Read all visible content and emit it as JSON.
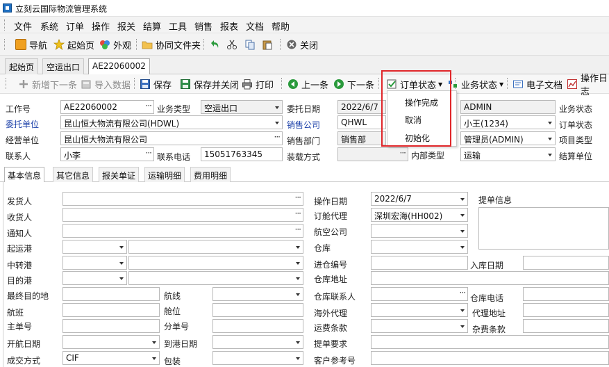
{
  "app": {
    "title": "立刻云国际物流管理系统"
  },
  "menu": [
    "文件",
    "系统",
    "订单",
    "操作",
    "报关",
    "结算",
    "工具",
    "销售",
    "报表",
    "文档",
    "帮助"
  ],
  "toolbar": {
    "nav": "导航",
    "home": "起始页",
    "appearance": "外观",
    "shared": "协同文件夹",
    "close": "关闭"
  },
  "doc_tabs": [
    "起始页",
    "空运出口",
    "AE22060002"
  ],
  "actions": {
    "add_next": "新增下一条",
    "import": "导入数据",
    "save": "保存",
    "save_close": "保存并关闭",
    "print": "打印",
    "prev": "上一条",
    "next": "下一条",
    "order_status": "订单状态",
    "biz_status": "业务状态",
    "e_docs": "电子文档",
    "op_log": "操作日志"
  },
  "status_menu": [
    "操作完成",
    "取消",
    "初始化"
  ],
  "header_form": {
    "job_no_label": "工作号",
    "job_no": "AE22060002",
    "biz_type_label": "业务类型",
    "biz_type": "空运出口",
    "entrust_date_label": "委托日期",
    "entrust_date": "2022/6/7",
    "creator": "ADMIN",
    "biz_status_label": "业务状态",
    "client_label": "委托单位",
    "client": "昆山恒大物流有限公司(HDWL)",
    "sales_co_label": "销售公司",
    "sales_co": "QHWL",
    "salesman": "小王(1234)",
    "order_status_label": "订单状态",
    "operator_label": "经营单位",
    "operator": "昆山恒大物流有限公司",
    "sales_dept_label": "销售部门",
    "sales_dept": "销售部",
    "manager": "管理员(ADMIN)",
    "project_type_label": "项目类型",
    "contact_label": "联系人",
    "contact": "小李",
    "phone_label": "联系电话",
    "phone": "15051763345",
    "loading_label": "装载方式",
    "internal_type_label": "内部类型",
    "internal_type": "运输",
    "settle_unit_label": "结算单位"
  },
  "sub_tabs": [
    "基本信息",
    "其它信息",
    "报关单证",
    "运输明细",
    "费用明细"
  ],
  "basic": {
    "shipper": "发货人",
    "consignee": "收货人",
    "notify": "通知人",
    "pol": "起运港",
    "transit": "中转港",
    "pod": "目的港",
    "final_dest": "最终目的地",
    "route": "航线",
    "flight": "航班",
    "space": "舱位",
    "mawb": "主单号",
    "hawb": "分单号",
    "etd": "开航日期",
    "eta": "到港日期",
    "trade_terms": "成交方式",
    "trade_terms_val": "CIF",
    "packing": "包装",
    "op_date": "操作日期",
    "op_date_val": "2022/6/7",
    "booking_agent": "订舱代理",
    "booking_agent_val": "深圳宏海(HH002)",
    "airline": "航空公司",
    "warehouse": "仓库",
    "wh_in_no": "进仓编号",
    "wh_in_date": "入库日期",
    "wh_addr": "仓库地址",
    "wh_contact": "仓库联系人",
    "wh_phone": "仓库电话",
    "overseas_agent": "海外代理",
    "agent_addr": "代理地址",
    "freight_terms": "运费条款",
    "misc_terms": "杂费条款",
    "bl_req": "提单要求",
    "cust_ref": "客户参考号",
    "bl_info": "提单信息"
  },
  "colors": {
    "highlight": "#e0262a",
    "link_blue": "#1a3fa8"
  }
}
